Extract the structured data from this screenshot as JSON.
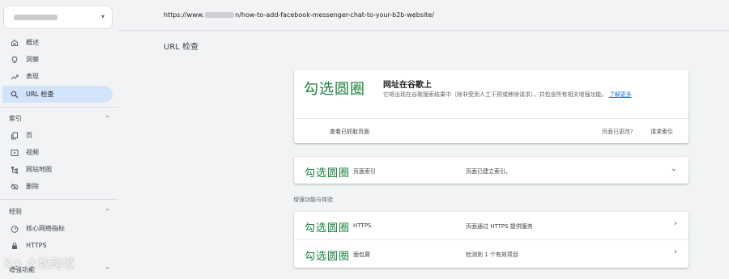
{
  "sidebar": {
    "property_caret": "▾",
    "items": [
      {
        "label": "概述",
        "icon": "home-icon"
      },
      {
        "label": "洞察",
        "icon": "lightbulb-icon"
      },
      {
        "label": "表现",
        "icon": "trending-up-icon"
      },
      {
        "label": "URL 检查",
        "icon": "search-icon",
        "active": true
      }
    ],
    "sections": [
      {
        "label": "索引",
        "items": [
          {
            "label": "页",
            "icon": "pages-icon"
          },
          {
            "label": "视频",
            "icon": "video-icon"
          },
          {
            "label": "网站地图",
            "icon": "sitemap-icon"
          },
          {
            "label": "删除",
            "icon": "remove-icon"
          }
        ]
      },
      {
        "label": "经验",
        "items": [
          {
            "label": "核心网络指标",
            "icon": "gauge-icon"
          },
          {
            "label": "HTTPS",
            "icon": "lock-icon"
          }
        ]
      },
      {
        "label": "增强功能",
        "items": []
      }
    ],
    "section_caret": "⌃"
  },
  "url_bar": {
    "prefix": "https://www.",
    "suffix": "n/how-to-add-facebook-messenger-chat-to-your-b2b-website/"
  },
  "page_title": "URL 检查",
  "summary_card": {
    "handwritten": "勾选圆圈",
    "title": "网址在谷歌上",
    "description": "它将出现在谷歌搜索结果中（除非受到人工干预或移除请求），并包含所有相关增强功能。",
    "learn_more": "了解更多",
    "view_crawled": "查看已抓取页面",
    "page_changed": "页面已更改?",
    "request_indexing": "请求索引"
  },
  "indexing_row": {
    "handwritten": "勾选圆圈",
    "label": "页面索引",
    "status": "页面已建立索引。",
    "chevron": "⌄"
  },
  "enhancements_heading": "增强功能与体验",
  "enhancement_rows": [
    {
      "handwritten": "勾选圆圈",
      "label": "HTTPS",
      "status": "页面通过 HTTPS 提供服务",
      "chevron": "›"
    },
    {
      "handwritten": "勾选圆圈",
      "label": "面包屑",
      "status": "检测到 1 个有效项目",
      "chevron": "›"
    }
  ],
  "watermark": "K⊙ 大数跨境",
  "colors": {
    "accent": "#1a73e8",
    "success": "#188038",
    "active_bg": "#d2e3fc"
  }
}
